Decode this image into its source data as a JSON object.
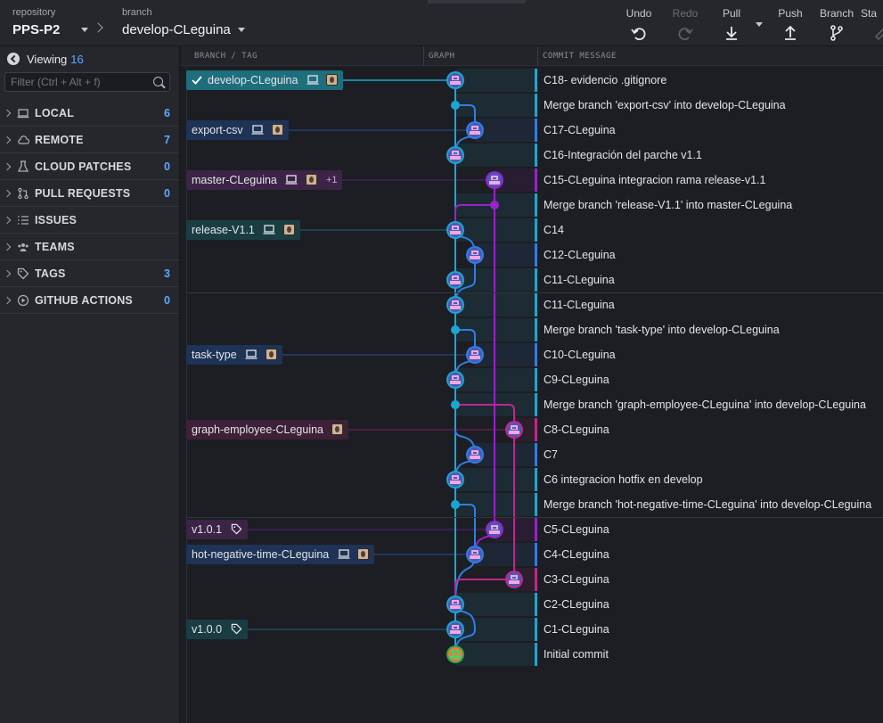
{
  "topbar": {
    "repo_label": "repository",
    "repo_name": "PPS-P2",
    "branch_label": "branch",
    "branch_name": "develop-CLeguina",
    "actions": [
      {
        "label": "Undo",
        "icon": "undo-icon",
        "enabled": true
      },
      {
        "label": "Redo",
        "icon": "redo-icon",
        "enabled": false
      },
      {
        "label": "Pull",
        "icon": "pull-icon",
        "enabled": true
      },
      {
        "label": "Push",
        "icon": "push-icon",
        "enabled": true
      },
      {
        "label": "Branch",
        "icon": "branch-icon",
        "enabled": true
      },
      {
        "label": "Sta",
        "icon": "stash-icon",
        "enabled": false
      }
    ]
  },
  "sidebar": {
    "viewing_label": "Viewing",
    "viewing_count": "16",
    "filter_placeholder": "Filter (Ctrl + Alt + f)",
    "sections": [
      {
        "label": "LOCAL",
        "count": "6",
        "icon": "laptop-icon"
      },
      {
        "label": "REMOTE",
        "count": "7",
        "icon": "cloud-icon"
      },
      {
        "label": "CLOUD PATCHES",
        "count": "0",
        "icon": "flask-icon"
      },
      {
        "label": "PULL REQUESTS",
        "count": "0",
        "icon": "pull-request-icon"
      },
      {
        "label": "ISSUES",
        "count": "",
        "icon": "list-icon"
      },
      {
        "label": "TEAMS",
        "count": "",
        "icon": "team-icon"
      },
      {
        "label": "TAGS",
        "count": "3",
        "icon": "tag-icon"
      },
      {
        "label": "GITHUB ACTIONS",
        "count": "0",
        "icon": "play-icon"
      }
    ]
  },
  "columns": {
    "branch_tag": "BRANCH / TAG",
    "graph": "GRAPH",
    "message": "COMMIT MESSAGE"
  },
  "colors": {
    "lane_cyan": "#1ba6d0",
    "lane_blue": "#2f7ee6",
    "lane_purple": "#9a22c8",
    "lane_magenta": "#c0268e"
  },
  "refs": {
    "develop": "develop-CLeguina",
    "export": "export-csv",
    "master": "master-CLeguina",
    "master_more": "+1",
    "release": "release-V1.1",
    "task": "task-type",
    "graph_employee": "graph-employee-CLeguina",
    "tag_v101": "v1.0.1",
    "hot_negative": "hot-negative-time-CLeguina",
    "tag_v100": "v1.0.0"
  },
  "commits": [
    "C18- evidencio .gitignore",
    "Merge branch 'export-csv' into develop-CLeguina",
    "C17-CLeguina",
    "C16-Integración del parche v1.1",
    "C15-CLeguina integracion rama release-v1.1",
    "Merge branch 'release-V1.1' into master-CLeguina",
    "C14",
    "C12-CLeguina",
    "C11-CLeguina",
    "C11-CLeguina",
    "Merge branch 'task-type' into develop-CLeguina",
    "C10-CLeguina",
    "C9-CLeguina",
    "Merge branch 'graph-employee-CLeguina' into develop-CLeguina",
    "C8-CLeguina",
    "C7",
    "C6 integracion hotfix en develop",
    "Merge branch 'hot-negative-time-CLeguina' into develop-CLeguina",
    "C5-CLeguina",
    "C4-CLeguina",
    "C3-CLeguina",
    "C2-CLeguina",
    "C1-CLeguina",
    "Initial commit"
  ]
}
